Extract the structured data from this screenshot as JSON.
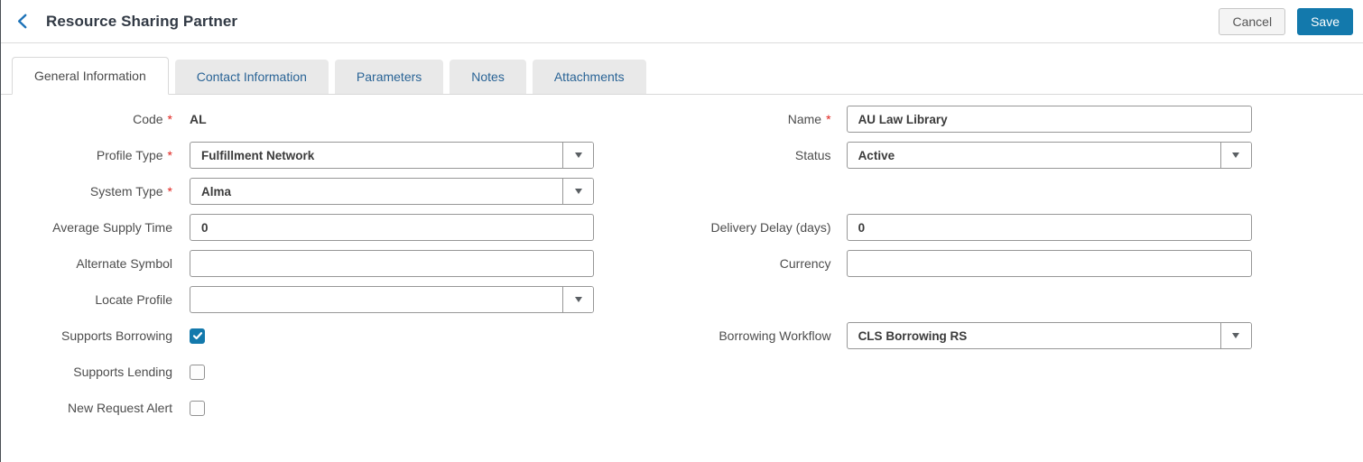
{
  "header": {
    "title": "Resource Sharing Partner",
    "actions": {
      "cancel": "Cancel",
      "save": "Save"
    }
  },
  "tabs": [
    {
      "label": "General Information",
      "active": true
    },
    {
      "label": "Contact Information",
      "active": false
    },
    {
      "label": "Parameters",
      "active": false
    },
    {
      "label": "Notes",
      "active": false
    },
    {
      "label": "Attachments",
      "active": false
    }
  ],
  "form": {
    "rows": [
      {
        "left": {
          "label": "Code",
          "required": true,
          "type": "static",
          "value": "AL"
        },
        "right": {
          "label": "Name",
          "required": true,
          "type": "text",
          "value": "AU Law Library"
        }
      },
      {
        "left": {
          "label": "Profile Type",
          "required": true,
          "type": "dropdown",
          "value": "Fulfillment Network"
        },
        "right": {
          "label": "Status",
          "required": false,
          "type": "dropdown",
          "value": "Active"
        }
      },
      {
        "left": {
          "label": "System Type",
          "required": true,
          "type": "dropdown",
          "value": "Alma"
        },
        "right": null
      },
      {
        "left": {
          "label": "Average Supply Time",
          "required": false,
          "type": "text",
          "value": "0"
        },
        "right": {
          "label": "Delivery Delay (days)",
          "required": false,
          "type": "text",
          "value": "0"
        }
      },
      {
        "left": {
          "label": "Alternate Symbol",
          "required": false,
          "type": "text",
          "value": ""
        },
        "right": {
          "label": "Currency",
          "required": false,
          "type": "text",
          "value": ""
        }
      },
      {
        "left": {
          "label": "Locate Profile",
          "required": false,
          "type": "dropdown",
          "value": ""
        },
        "right": null
      },
      {
        "left": {
          "label": "Supports Borrowing",
          "required": false,
          "type": "checkbox",
          "checked": true
        },
        "right": {
          "label": "Borrowing Workflow",
          "required": false,
          "type": "dropdown",
          "value": "CLS Borrowing RS"
        }
      },
      {
        "left": {
          "label": "Supports Lending",
          "required": false,
          "type": "checkbox",
          "checked": false
        },
        "right": null
      },
      {
        "left": {
          "label": "New Request Alert",
          "required": false,
          "type": "checkbox",
          "checked": false
        },
        "right": null
      }
    ]
  },
  "colors": {
    "accent_blue": "#1379AC",
    "tab_link_blue": "#2A6496",
    "back_arrow_blue": "#1E73B8",
    "required_red": "#E0231E"
  }
}
